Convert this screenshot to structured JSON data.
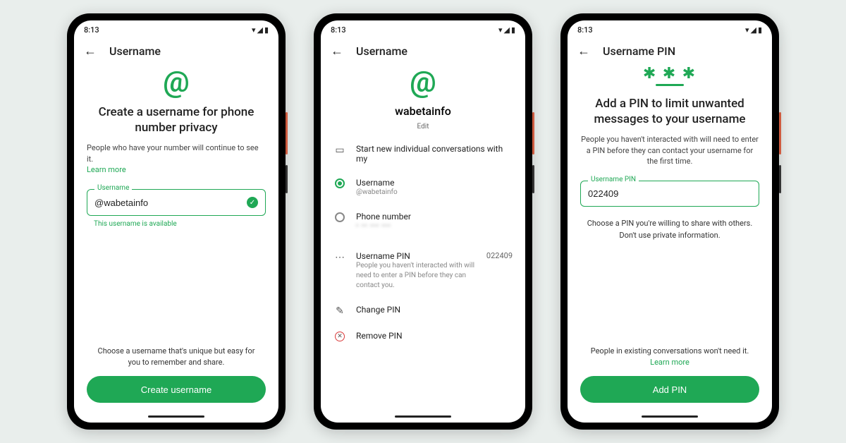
{
  "status": {
    "time": "8:13"
  },
  "screen1": {
    "title": "Username",
    "headline": "Create a username for phone number privacy",
    "sub": "People who have your number will continue to see it.",
    "learn": "Learn more",
    "field_label": "Username",
    "field_value": "@wabetainfo",
    "helper": "This username is available",
    "footer": "Choose a username that's unique but easy for you to remember and share.",
    "cta": "Create username"
  },
  "screen2": {
    "title": "Username",
    "profile": "wabetainfo",
    "edit": "Edit",
    "section_header": "Start new individual conversations with my",
    "opt_username_label": "Username",
    "opt_username_value": "@wabetainfo",
    "opt_phone_label": "Phone number",
    "opt_phone_value": "• •• ••• •••",
    "pin_row_title": "Username PIN",
    "pin_row_desc": "People you haven't interacted with will need to enter a PIN before they can contact you.",
    "pin_value": "022409",
    "change_pin": "Change PIN",
    "remove_pin": "Remove PIN"
  },
  "screen3": {
    "title": "Username PIN",
    "headline": "Add a PIN to limit unwanted messages to your username",
    "sub": "People you haven't interacted with will need to enter a PIN before they can contact your username for the first time.",
    "field_label": "Username PIN",
    "field_value": "022409",
    "helper": "Choose a PIN you're willing to share with others. Don't use private information.",
    "footer": "People in existing conversations won't need it.",
    "learn": "Learn more",
    "cta": "Add PIN"
  }
}
